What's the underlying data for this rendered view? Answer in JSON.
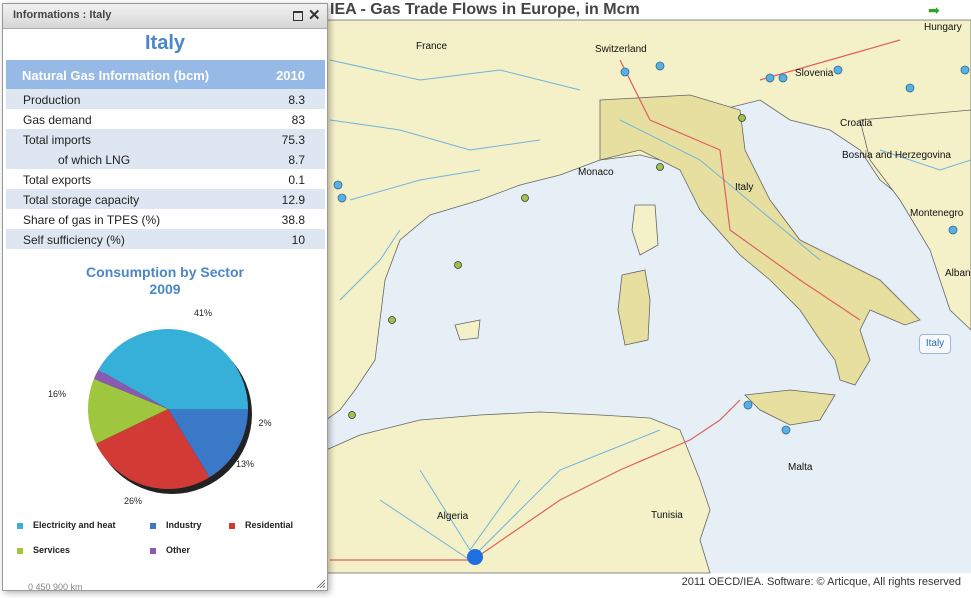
{
  "map": {
    "title": "IEA - Gas Trade Flows in Europe, in Mcm",
    "footer": "2011 OECD/IEA. Software: © Articque, All rights reserved",
    "labels": [
      "France",
      "Switzerland",
      "Slovenia",
      "Hungary",
      "Croatia",
      "Bosnia and Herzegovina",
      "Montenegro",
      "Albania",
      "Monaco",
      "Italy",
      "Tunisia",
      "Algeria",
      "Malta"
    ],
    "callout": "Italy",
    "arrow_icon": "green-arrow-icon"
  },
  "panel": {
    "header_title": "Informations : Italy",
    "country": "Italy",
    "table": {
      "header_label": "Natural Gas Information (bcm)",
      "header_year": "2010",
      "rows": [
        {
          "label": "Production",
          "value": "8.3"
        },
        {
          "label": "Gas demand",
          "value": "83"
        },
        {
          "label": "Total imports",
          "value": "75.3"
        },
        {
          "label": "of which LNG",
          "value": "8.7"
        },
        {
          "label": "Total exports",
          "value": "0.1"
        },
        {
          "label": "Total storage capacity",
          "value": "12.9"
        },
        {
          "label": "Share of gas in TPES (%)",
          "value": "38.8"
        },
        {
          "label": "Self sufficiency (%)",
          "value": "10"
        }
      ]
    },
    "chart_title_line1": "Consumption by Sector",
    "chart_title_line2": "2009",
    "scale": "0      450      900 km"
  },
  "chart_data": {
    "type": "pie",
    "title": "Consumption by Sector 2009",
    "slices": [
      {
        "name": "Electricity and heat",
        "value": 41,
        "label": "41%",
        "color": "#36b0d8"
      },
      {
        "name": "Industry",
        "value": 16,
        "label": "16%",
        "color": "#3a78c8"
      },
      {
        "name": "Residential",
        "value": 26,
        "label": "26%",
        "color": "#d23a36"
      },
      {
        "name": "Services",
        "value": 13,
        "label": "13%",
        "color": "#9ec63f"
      },
      {
        "name": "Other",
        "value": 2,
        "label": "2%",
        "color": "#8a5ab0"
      }
    ],
    "legend_placement": "bottom"
  }
}
